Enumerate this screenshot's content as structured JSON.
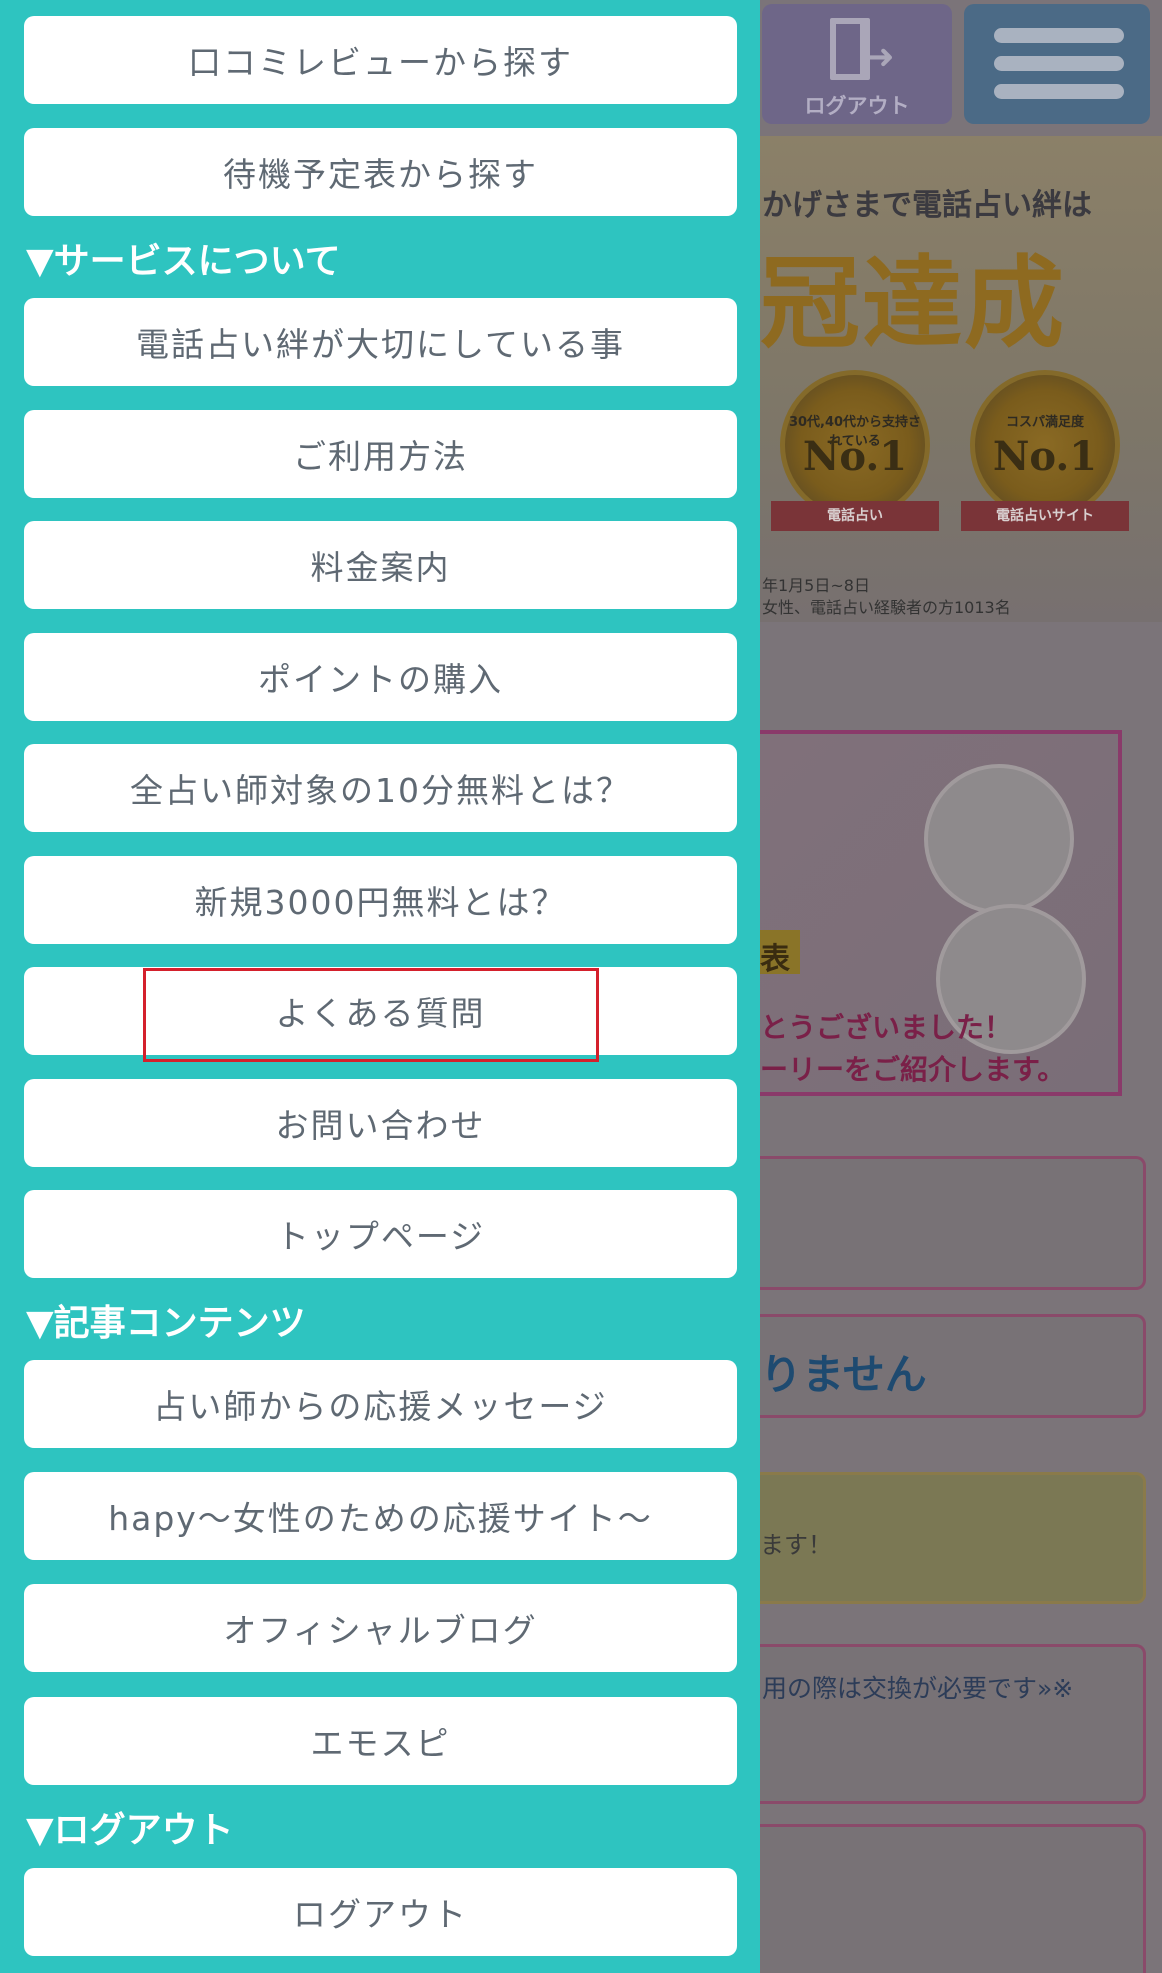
{
  "header": {
    "logout_button_label": "ログアウト",
    "menu_button_icon": "hamburger-icon",
    "logout_button_icon": "door-exit-icon"
  },
  "background": {
    "banner_top": {
      "subtitle": "かげさまで電話占い絆は",
      "headline": "冠達成",
      "medal_a": {
        "caption": "30代,40代から支持されている",
        "rank": "No.1",
        "ribbon": "電話占い"
      },
      "medal_b": {
        "caption": "コスパ満足度",
        "rank": "No.1",
        "ribbon": "電話占いサイト"
      },
      "note_line1": "年1月5日~8日",
      "note_line2": "女性、電話占い経験者の方1013名"
    },
    "banner_second": {
      "gold_label": "表",
      "line1": "とうございました！",
      "line2": "ーリーをご紹介します。"
    },
    "box2_text": "りません",
    "box3_text": "ます！",
    "box4_text": "用の際は交換が必要です»※"
  },
  "drawer": {
    "items_top": [
      "口コミレビューから探す",
      "待機予定表から探す"
    ],
    "section_service": "▼サービスについて",
    "items_service": [
      "電話占い絆が大切にしている事",
      "ご利用方法",
      "料金案内",
      "ポイントの購入",
      "全占い師対象の10分無料とは？",
      "新規3000円無料とは？",
      "よくある質問",
      "お問い合わせ",
      "トップページ"
    ],
    "section_articles": "▼記事コンテンツ",
    "items_articles": [
      "占い師からの応援メッセージ",
      "hapy～女性のための応援サイト～",
      "オフィシャルブログ",
      "エモスピ"
    ],
    "section_logout": "▼ログアウト",
    "items_logout": [
      "ログアウト"
    ],
    "highlight_color": "#d4202c"
  },
  "colors": {
    "drawer_bg": "#2ec4c0",
    "item_text": "#5f6973",
    "overlay_dim": "#7a7378"
  }
}
